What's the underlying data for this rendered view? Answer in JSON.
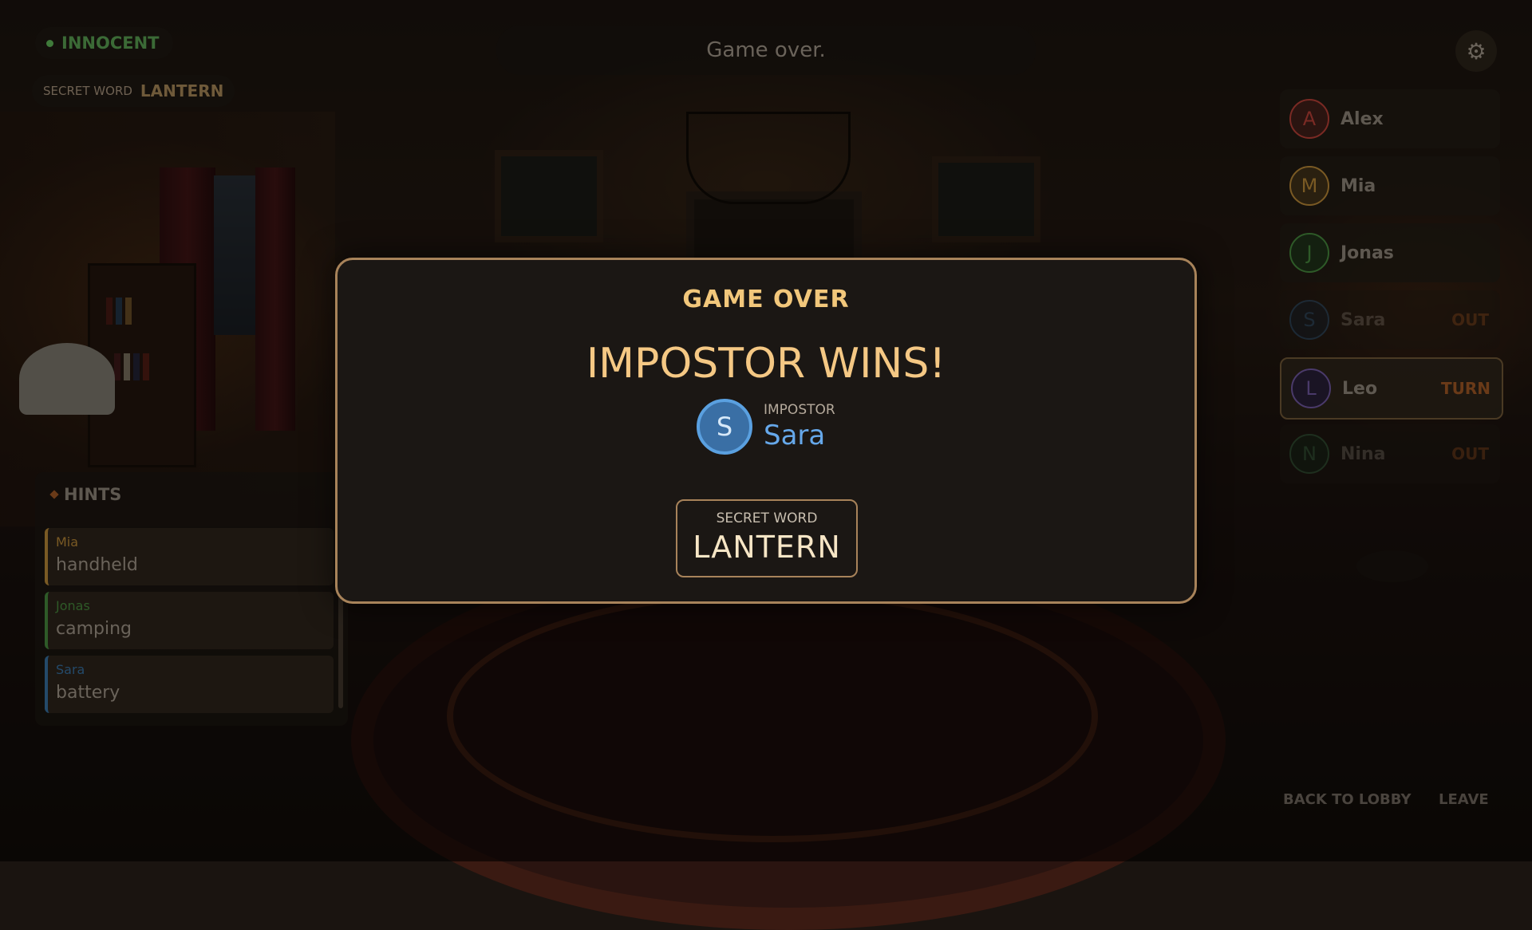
{
  "hud": {
    "role": "INNOCENT",
    "secret_word_label": "SECRET WORD",
    "secret_word_value": "LANTERN",
    "status": "Game over.",
    "settings_icon": "gear-icon"
  },
  "players": [
    {
      "initial": "A",
      "name": "Alex",
      "tag": "",
      "color": "#7a2a24",
      "state": "normal"
    },
    {
      "initial": "M",
      "name": "Mia",
      "tag": "",
      "color": "#7a5a24",
      "state": "normal"
    },
    {
      "initial": "J",
      "name": "Jonas",
      "tag": "",
      "color": "#2e5a28",
      "state": "normal"
    },
    {
      "initial": "S",
      "name": "Sara",
      "tag": "OUT",
      "color": "#244a6a",
      "state": "out"
    },
    {
      "initial": "L",
      "name": "Leo",
      "tag": "TURN",
      "color": "#4a3a6a",
      "state": "turn"
    },
    {
      "initial": "N",
      "name": "Nina",
      "tag": "OUT",
      "color": "#2e5a3a",
      "state": "out"
    }
  ],
  "hints": {
    "title": "HINTS",
    "items": [
      {
        "player": "Mia",
        "word": "handheld",
        "color": "#7a5a24"
      },
      {
        "player": "Jonas",
        "word": "camping",
        "color": "#2e5a28"
      },
      {
        "player": "Sara",
        "word": "battery",
        "color": "#244a6a"
      }
    ]
  },
  "footer": {
    "back_to_lobby": "BACK TO LOBBY",
    "leave": "LEAVE"
  },
  "modal": {
    "title": "GAME OVER",
    "headline": "IMPOSTOR WINS!",
    "impostor_label": "IMPOSTOR",
    "impostor_initial": "S",
    "impostor_name": "Sara",
    "secret_word_label": "SECRET WORD",
    "secret_word_value": "LANTERN"
  }
}
